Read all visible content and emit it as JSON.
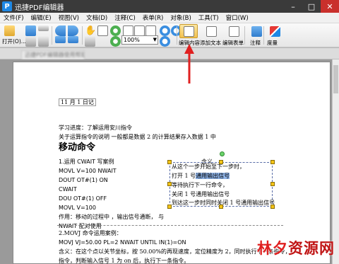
{
  "window": {
    "title": "迅捷PDF编辑器",
    "app_icon": "P"
  },
  "window_controls": {
    "minimize": "–",
    "maximize": "□",
    "close": "✕"
  },
  "menu": [
    "文件(F)",
    "编辑(E)",
    "视图(V)",
    "文档(D)",
    "注释(C)",
    "表单(R)",
    "对象(B)",
    "工具(T)",
    "窗口(W)"
  ],
  "toolbar": {
    "open_label": "打开(O)...",
    "zoom_value": "100%",
    "edit_content_label": "编辑内容",
    "add_text_label": "添加文本",
    "edit_form_label": "编辑表单",
    "annotate_label": "注释",
    "measure_label": "度量"
  },
  "tab": {
    "label": "迅捷PDF编辑器使用帮助文档.pdf"
  },
  "document": {
    "date": "11 月 1 日记",
    "lines": [
      "学习进度：了解运用安川指令",
      "关于运算指令的说明 一般都是数据 2 的计算结果存入数据 1 中"
    ],
    "heading": "移动命令",
    "left_block": [
      "1.运用 CWAIT 写案例",
      "MOVL V=100 NWAIT",
      "DOUT OT#(1) ON",
      "CWAIT",
      "DOU OT#(1) OFF",
      "MOVL V=100"
    ],
    "left_note": "作用：移动的过程中 ，输出信号通断，  与",
    "left_note2": "NWAIT 配对使用",
    "right_label": "含义",
    "right_block_pre": "从这个一步开始至下一步时，",
    "right_line2_pre": "打开 1 号",
    "right_line2_highlight": "通用输出信号",
    "right_lines_rest": [
      "等待执行下一行命令，",
      "关闭 1 号通用输出信号",
      "到达这一步时同时关闭 1 号通用输出信号"
    ],
    "section2_title": "2.MOVJ 命令运用案例：",
    "section2_cmd": "MOVJ   VJ=50.00   PL=2   NWAIT   UNTIL   IN(1)=ON",
    "section2_desc1": "含义：在这个点以关节坐标，按 50.00%的再现速度，定位精度为 2，同时执行下一条指令，",
    "section2_desc2": "指令，判断输入信号 1 为 on 后，执行下一条指令。"
  },
  "watermark": {
    "part1": "林夕",
    "part2": "资源网"
  },
  "colors": {
    "accent": "#f2c14e",
    "arrow": "#e02020",
    "selection_handle": "#f5c518"
  }
}
